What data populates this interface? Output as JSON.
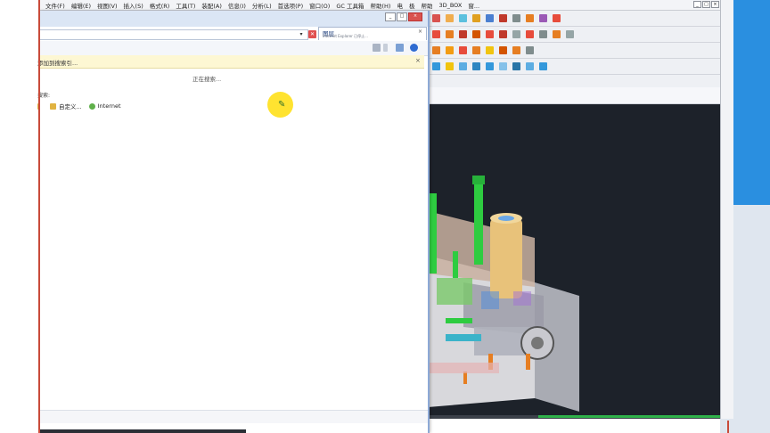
{
  "cad": {
    "menu": [
      "文件(F)",
      "编辑(E)",
      "视图(V)",
      "插入(S)",
      "格式(R)",
      "工具(T)",
      "装配(A)",
      "信息(I)",
      "分析(L)",
      "首选项(P)",
      "窗口(O)",
      "GC 工具箱",
      "帮助(H)",
      "电",
      "极",
      "帮助",
      "3D_BOX",
      "窗..."
    ],
    "colors": {
      "viewport_bg": "#1d222a",
      "accent": "#2fb24a"
    }
  },
  "browser": {
    "tab_title": "图层",
    "tab_subtitle": "Internet Explorer 已停止...",
    "tab_close": "×",
    "stop_label": "✕",
    "info_bar_text": "添加到搜索引...",
    "info_close": "×",
    "status_text": "正在搜索...",
    "search_label": "搜索:",
    "shortcuts": [
      {
        "label": "自定义...",
        "icon": "folder-icon"
      },
      {
        "label": "Internet",
        "icon": "globe-icon"
      }
    ]
  },
  "window_controls": {
    "minimize": "_",
    "maximize": "□",
    "close": "×"
  }
}
